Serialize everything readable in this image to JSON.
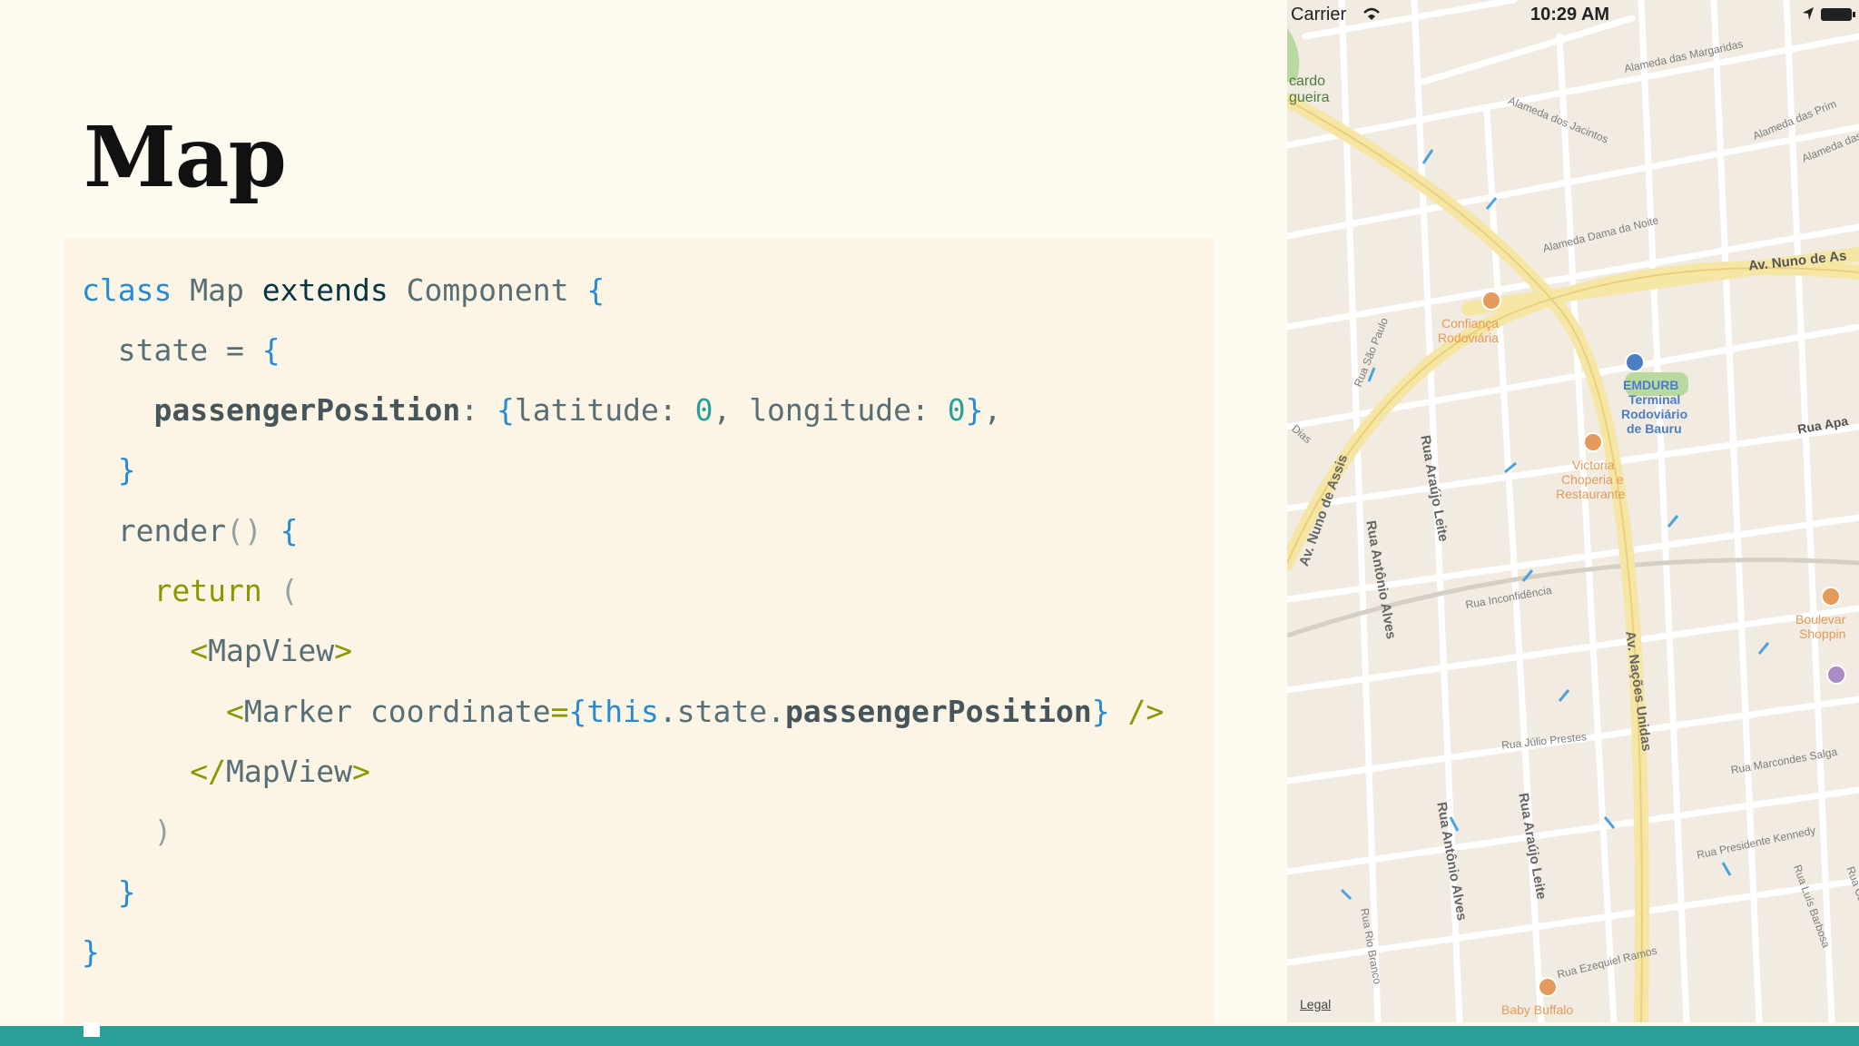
{
  "slide": {
    "title": "Map"
  },
  "code": {
    "l1": {
      "kw": "class",
      "name": "Map",
      "ext": "extends",
      "base": "Component",
      "brace": "{"
    },
    "l2": {
      "prop": "state",
      "eq": "=",
      "brace": "{"
    },
    "l3": {
      "key": "passengerPosition",
      "colon": ":",
      "ob": "{",
      "lat": "latitude:",
      "zero1": "0",
      "comma": ",",
      "lng": "longitude:",
      "zero2": "0",
      "cb": "}",
      "end": ","
    },
    "l4": {
      "brace": "}"
    },
    "l5": {
      "fn": "render",
      "parens": "()",
      "brace": "{"
    },
    "l6": {
      "kw": "return",
      "paren": "("
    },
    "l7": {
      "open": "<",
      "tag": "MapView",
      "close": ">"
    },
    "l8": {
      "open": "<",
      "tag": "Marker",
      "attr": "coordinate",
      "eq": "=",
      "ob": "{",
      "this": "this",
      "dot1": ".",
      "state": "state",
      "dot2": ".",
      "pp": "passengerPosition",
      "cb": "}",
      "selfclose": "/>"
    },
    "l9": {
      "open": "</",
      "tag": "MapView",
      "close": ">"
    },
    "l10": {
      "paren": ")"
    },
    "l11": {
      "brace": "}"
    },
    "l12": {
      "brace": "}"
    }
  },
  "map": {
    "status": {
      "carrier": "Carrier",
      "time": "10:29 AM"
    },
    "labels": {
      "cardo": "cardo",
      "gueira": "gueira",
      "alameda_margaridas": "Alameda das Margaridas",
      "alameda_jacintos": "Alameda dos Jacintos",
      "alameda_prim": "Alameda das Prim",
      "alameda_das": "Alameda das",
      "alameda_dama": "Alameda Dama da Noite",
      "av_nuno": "Av. Nuno de As",
      "rua_sao_paulo": "Rua São Paulo",
      "confianca_1": "Confiança",
      "confianca_2": "Rodoviária",
      "emdurb_1": "EMDURB",
      "emdurb_2": "Terminal",
      "emdurb_3": "Rodoviário",
      "emdurb_4": "de Bauru",
      "rua_apa": "Rua Apa",
      "victoria_1": "Victoria",
      "victoria_2": "Choperia e",
      "victoria_3": "Restaurante",
      "dias": "Dias",
      "av_nuno_assis": "Av. Nuno de Assis",
      "rua_antonio_alves": "Rua Antônio Alves",
      "rua_araujo_leite": "Rua Araújo Leite",
      "rua_inconfidencia": "Rua Inconfidência",
      "boulevard_1": "Boulevar",
      "boulevard_2": "Shoppin",
      "av_nacoes": "Av. Nações Unidas",
      "rua_julio": "Rua Júlio Prestes",
      "rua_marcondes": "Rua Marcondes Salga",
      "rua_antonio_alves_2": "Rua Antônio Alves",
      "rua_araujo_leite_2": "Rua Araújo Leite",
      "rua_presidente": "Rua Presidente Kennedy",
      "rua_ezequiel": "Rua Ezequiel Ramos",
      "rua_rio_branco": "Rua Rio Branco",
      "rua_luis": "Rua Luís Barbosa",
      "rua_cara": "Rua Caravelas",
      "baby_buffalo": "Baby Buffalo",
      "legal": "Legal"
    },
    "colors": {
      "background": "#f1ebe2",
      "major_road": "#f6e6a6",
      "street": "#ffffff",
      "accent_bar": "#2aa198"
    }
  }
}
